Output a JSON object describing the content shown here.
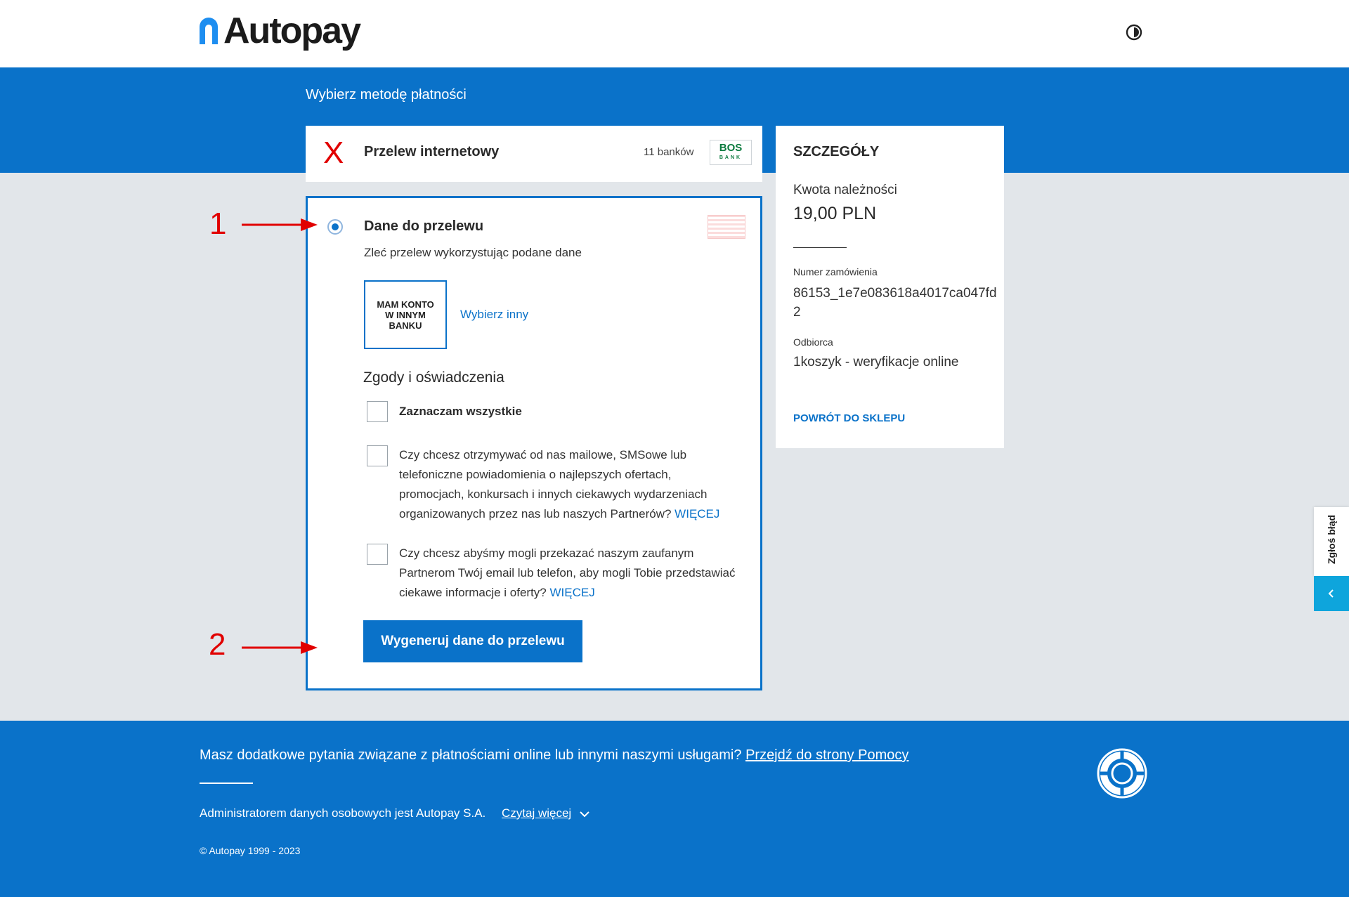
{
  "header": {
    "logo_text": "Autopay",
    "contrast_icon": "contrast-toggle-icon"
  },
  "page": {
    "heading": "Wybierz metodę płatności"
  },
  "method": {
    "label": "Przelew internetowy",
    "bank_count": "11 banków",
    "bank_logo_text": "BOS",
    "bank_logo_sub": "BANK"
  },
  "transfer": {
    "title": "Dane do przelewu",
    "subtitle": "Zleć przelew wykorzystując podane dane",
    "other_bank_label": "MAM KONTO W INNYM BANKU",
    "choose_other_link": "Wybierz inny",
    "consents_title": "Zgody i oświadczenia",
    "select_all_label": "Zaznaczam wszystkie",
    "consent_1": "Czy chcesz otrzymywać od nas mailowe, SMSowe lub telefoniczne powiadomienia o najlepszych ofertach, promocjach, konkursach i innych ciekawych wydarzeniach organizowanych przez nas lub naszych Partnerów?",
    "consent_2": "Czy chcesz abyśmy mogli przekazać naszym zaufanym Partnerom Twój email lub telefon, aby mogli Tobie przedstawiać ciekawe informacje i oferty?",
    "more_link": "WIĘCEJ",
    "generate_button": "Wygeneruj dane do przelewu"
  },
  "annotations": {
    "marker_1": "1",
    "marker_2": "2",
    "cross_mark": "X"
  },
  "details": {
    "title": "SZCZEGÓŁY",
    "amount_label": "Kwota należności",
    "amount": "19,00 PLN",
    "order_label": "Numer zamówienia",
    "order_number": "86153_1e7e083618a4017ca047fd2",
    "recipient_label": "Odbiorca",
    "recipient": "1koszyk - weryfikacje online",
    "back_link": "POWRÓT DO SKLEPU"
  },
  "report": {
    "tab_label": "Zgłoś błąd"
  },
  "footer": {
    "question": "Masz dodatkowe pytania związane z płatnościami online lub innymi naszymi usługami?",
    "help_link": "Przejdź do strony Pomocy",
    "admin_text": "Administratorem danych osobowych jest Autopay S.A.",
    "read_more": "Czytaj więcej",
    "copyright": "© Autopay 1999 - 2023"
  },
  "colors": {
    "brand_blue": "#0a72c9",
    "annotation_red": "#e10000",
    "report_cyan": "#0ea5dc"
  }
}
